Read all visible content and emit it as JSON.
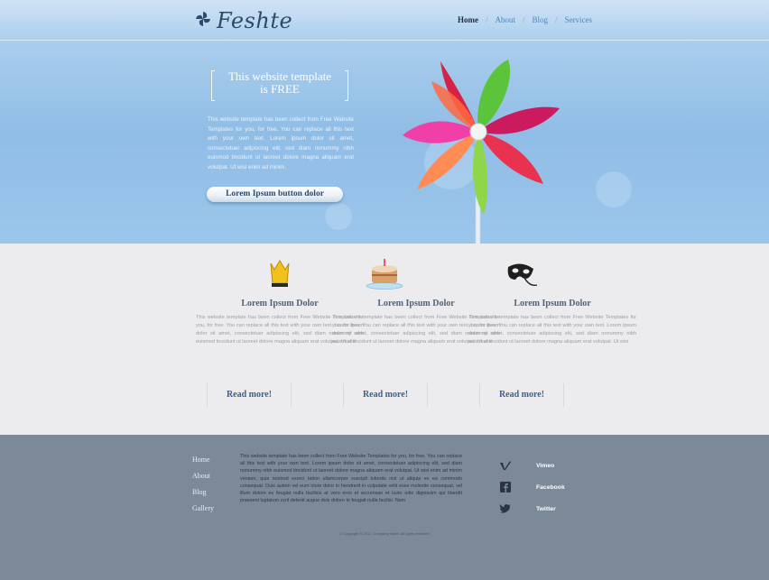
{
  "header": {
    "logo_text": "Feshte",
    "logo_icon": "pinwheel-logo-icon",
    "nav": [
      {
        "label": "Home",
        "active": true
      },
      {
        "label": "About",
        "active": false
      },
      {
        "label": "Blog",
        "active": false
      },
      {
        "label": "Services",
        "active": false
      }
    ]
  },
  "hero": {
    "promo_line1": "This website template",
    "promo_is": "is",
    "promo_free": "FREE",
    "body": "This website template has been collect from Free Website Templates for you, for free. You can replace all this text with your own text. Lorem ipsum dolor sit amet, consectetuer adipiscing elit, sed diam nonummy nibh euismod tincidunt ut laoreet dolore magna aliquam erat volutpat. Ut wisi enim ad minim.",
    "button_label": "Lorem Ipsum button dolor",
    "image": "pinwheel"
  },
  "features": [
    {
      "icon": "crown-icon",
      "title": "Lorem Ipsum Dolor",
      "text": "This website template has been collect from Free Website Templates for you, for free. You can replace all this text with your own text. Lorem ipsum dolor sit amet, consectetuer adipiscing elit, sed diam nonummy nibh euismod tincidunt ut laoreet dolore magna aliquam erat volutpat. Ut wisi",
      "more": "Read more!"
    },
    {
      "icon": "cake-icon",
      "title": "Lorem Ipsum Dolor",
      "text": "This website template has been collect from Free Website Templates for you, for free. You can replace all this text with your own text. Lorem ipsum dolor sit amet, consectetuer adipiscing elit, sed diam nonummy nibh euismod tincidunt ut laoreet dolore magna aliquam erat volutpat. Ut wisi",
      "more": "Read more!"
    },
    {
      "icon": "mask-icon",
      "title": "Lorem Ipsum Dolor",
      "text": "This website template has been collect from Free Website Templates for you, for free. You can replace all this text with your own text. Lorem ipsum dolor sit amet, consectetuer adipiscing elit, sed diam nonummy nibh euismod tincidunt ut laoreet dolore magna aliquam erat volutpat. Ut wisi",
      "more": "Read more!"
    }
  ],
  "footer": {
    "nav": [
      "Home",
      "About",
      "Blog",
      "Gallery"
    ],
    "text": "This website template has been collect from Free Website Templates for you, for free. You can replace all this text with your own text. Lorem ipsum dolor sit amet, consectetuer adipiscing elit, sed diam nonummy nibh euismod tincidunt ut laoreet dolore magna aliquam erat volutpat. Ut wisi enim ad minim veniam, quis nostrud exerci tation ullamcorper suscipit lobortis nisl ut aliquip ex ea commodo consequat. Duis autem vel eum iriure dolor in hendrerit in vulputate velit esse molestie consequat, vel illum dolore eu feugiat nulla facilisis at vero eros et accumsan et iusto odio dignissim qui blandit praesent luptatum zzril delenit augue duis dolore te feugait nulla facilisi. Nam",
    "social": [
      {
        "icon": "vimeo-icon",
        "label": "Vimeo"
      },
      {
        "icon": "facebook-icon",
        "label": "Facebook"
      },
      {
        "icon": "twitter-icon",
        "label": "Twitter"
      }
    ],
    "copyright": "© Copyright © 2011. Company name. All rights reserved"
  },
  "colors": {
    "hero_blue": "#9bc6ec",
    "footer_slate": "#7b8998",
    "link_blue": "#4f86c0",
    "heading_gray": "#556270"
  }
}
